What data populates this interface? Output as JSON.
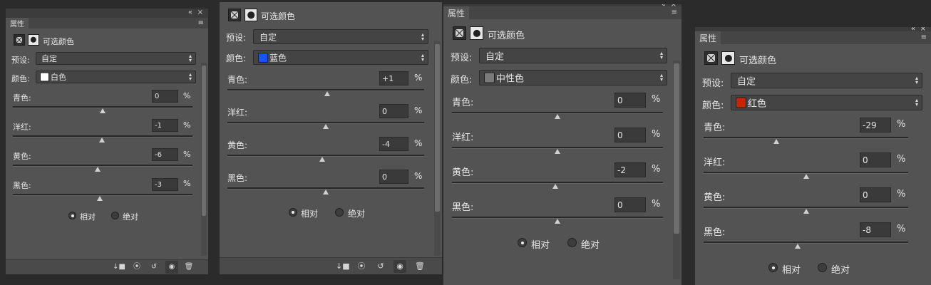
{
  "panel_tab": "属性",
  "collapse_glyph": "«",
  "close_glyph": "×",
  "menu_glyph": "≡",
  "adjustment_title": "可选颜色",
  "preset_label": "预设:",
  "preset_value": "自定",
  "color_label": "颜色:",
  "percent": "%",
  "channels": {
    "cyan": "青色:",
    "magenta": "洋红:",
    "yellow": "黄色:",
    "black": "黑色:"
  },
  "mode": {
    "relative": "相对",
    "absolute": "绝对"
  },
  "footer_icons": {
    "clip": "↓■",
    "visibility_prev": "⦿",
    "reset": "↺",
    "eye": "◉",
    "trash": "🗑"
  },
  "panels": [
    {
      "color_name": "白色",
      "swatch": "#ffffff",
      "values": {
        "cyan": "0",
        "magenta": "-1",
        "yellow": "-6",
        "black": "-3"
      },
      "mode_selected": "relative"
    },
    {
      "color_name": "蓝色",
      "swatch": "#1553ff",
      "values": {
        "cyan": "+1",
        "magenta": "0",
        "yellow": "-4",
        "black": "0"
      },
      "mode_selected": "relative"
    },
    {
      "color_name": "中性色",
      "swatch": "#7a7a7a",
      "values": {
        "cyan": "0",
        "magenta": "0",
        "yellow": "-2",
        "black": "0"
      },
      "mode_selected": "relative"
    },
    {
      "color_name": "红色",
      "swatch": "#cc2200",
      "values": {
        "cyan": "-29",
        "magenta": "0",
        "yellow": "0",
        "black": "-8"
      },
      "mode_selected": "relative"
    }
  ]
}
